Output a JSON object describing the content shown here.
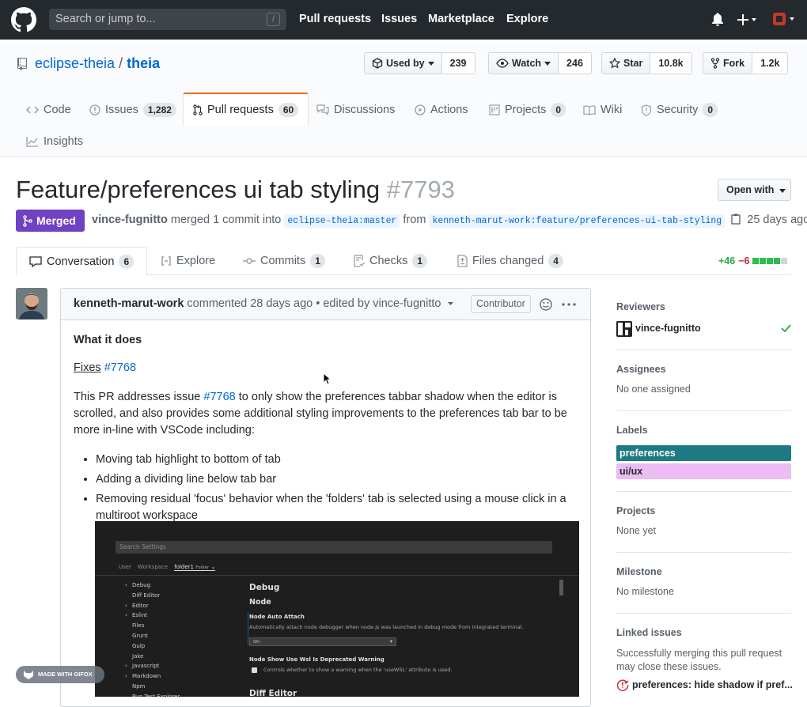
{
  "header": {
    "search_placeholder": "Search or jump to...",
    "slash_key": "/",
    "nav": [
      "Pull requests",
      "Issues",
      "Marketplace",
      "Explore"
    ]
  },
  "repo": {
    "owner": "eclipse-theia",
    "separator": "/",
    "name": "theia",
    "used_by_label": "Used by",
    "used_by_count": "239",
    "watch_label": "Watch",
    "watch_count": "246",
    "star_label": "Star",
    "star_count": "10.8k",
    "fork_label": "Fork",
    "fork_count": "1.2k"
  },
  "tabs": {
    "code": "Code",
    "issues": "Issues",
    "issues_count": "1,282",
    "pulls": "Pull requests",
    "pulls_count": "60",
    "discussions": "Discussions",
    "actions": "Actions",
    "projects": "Projects",
    "projects_count": "0",
    "wiki": "Wiki",
    "security": "Security",
    "security_count": "0",
    "insights": "Insights"
  },
  "pr": {
    "title": "Feature/preferences ui tab styling",
    "number": "#7793",
    "open_with": "Open with",
    "state": "Merged",
    "merger": "vince-fugnitto",
    "merged_text": "merged 1 commit into",
    "base_ref": "eclipse-theia:master",
    "from_text": "from",
    "head_ref": "kenneth-marut-work:feature/preferences-ui-tab-styling",
    "time_ago": "25 days ago"
  },
  "pr_tabs": {
    "conversation": "Conversation",
    "conversation_count": "6",
    "explore": "Explore",
    "commits": "Commits",
    "commits_count": "1",
    "checks": "Checks",
    "checks_count": "1",
    "files": "Files changed",
    "files_count": "4",
    "additions": "+46",
    "deletions": "−6"
  },
  "comment": {
    "author": "kenneth-marut-work",
    "meta": "commented 28 days ago • edited by vince-fugnitto",
    "badge": "Contributor",
    "heading": "What it does",
    "fixes_label": "Fixes",
    "fixes_link": "#7768",
    "para_start": "This PR addresses issue",
    "para_link": "#7768",
    "para_end": "to only show the preferences tabbar shadow when the editor is scrolled, and also provides some additional styling improvements to the preferences tab bar to be more in-line with VSCode including:",
    "bullets": [
      "Moving tab highlight to bottom of tab",
      "Adding a dividing line below tab bar",
      "Removing residual 'focus' behavior when the 'folders' tab is selected using a mouse click in a multiroot workspace"
    ]
  },
  "screenshot": {
    "search": "Search Settings",
    "scopes": [
      "User",
      "Workspace",
      "folder1"
    ],
    "folder_tag": "Folder",
    "tree": [
      "Debug",
      "Diff Editor",
      "Editor",
      "Eslint",
      "Files",
      "Grunt",
      "Gulp",
      "Jake",
      "Javascript",
      "Markdown",
      "Npm",
      "Pug Test Explorer"
    ],
    "section": "Debug",
    "subsection": "Node",
    "pref1_title": "Node Auto Attach",
    "pref1_desc": "Automatically attach node debugger when node.js was launched in debug mode from integrated terminal.",
    "pref1_value": "on",
    "pref2_title": "Node Show Use Wsl Is Deprecated Warning",
    "pref2_desc": "Controls whether to show a warning when the 'useWSL' attribute is used.",
    "next_section": "Diff Editor"
  },
  "sidebar": {
    "reviewers_title": "Reviewers",
    "reviewer": "vince-fugnitto",
    "assignees_title": "Assignees",
    "assignees_value": "No one assigned",
    "labels_title": "Labels",
    "labels": [
      {
        "name": "preferences",
        "color": "#1d7a82"
      },
      {
        "name": "ui/ux",
        "color": "#ebbdf2"
      }
    ],
    "projects_title": "Projects",
    "projects_value": "None yet",
    "milestone_title": "Milestone",
    "milestone_value": "No milestone",
    "linked_title": "Linked issues",
    "linked_text": "Successfully merging this pull request may close these issues.",
    "linked_issue": "preferences: hide shadow if pref..."
  },
  "watermark": "MADE WITH GIFOX"
}
